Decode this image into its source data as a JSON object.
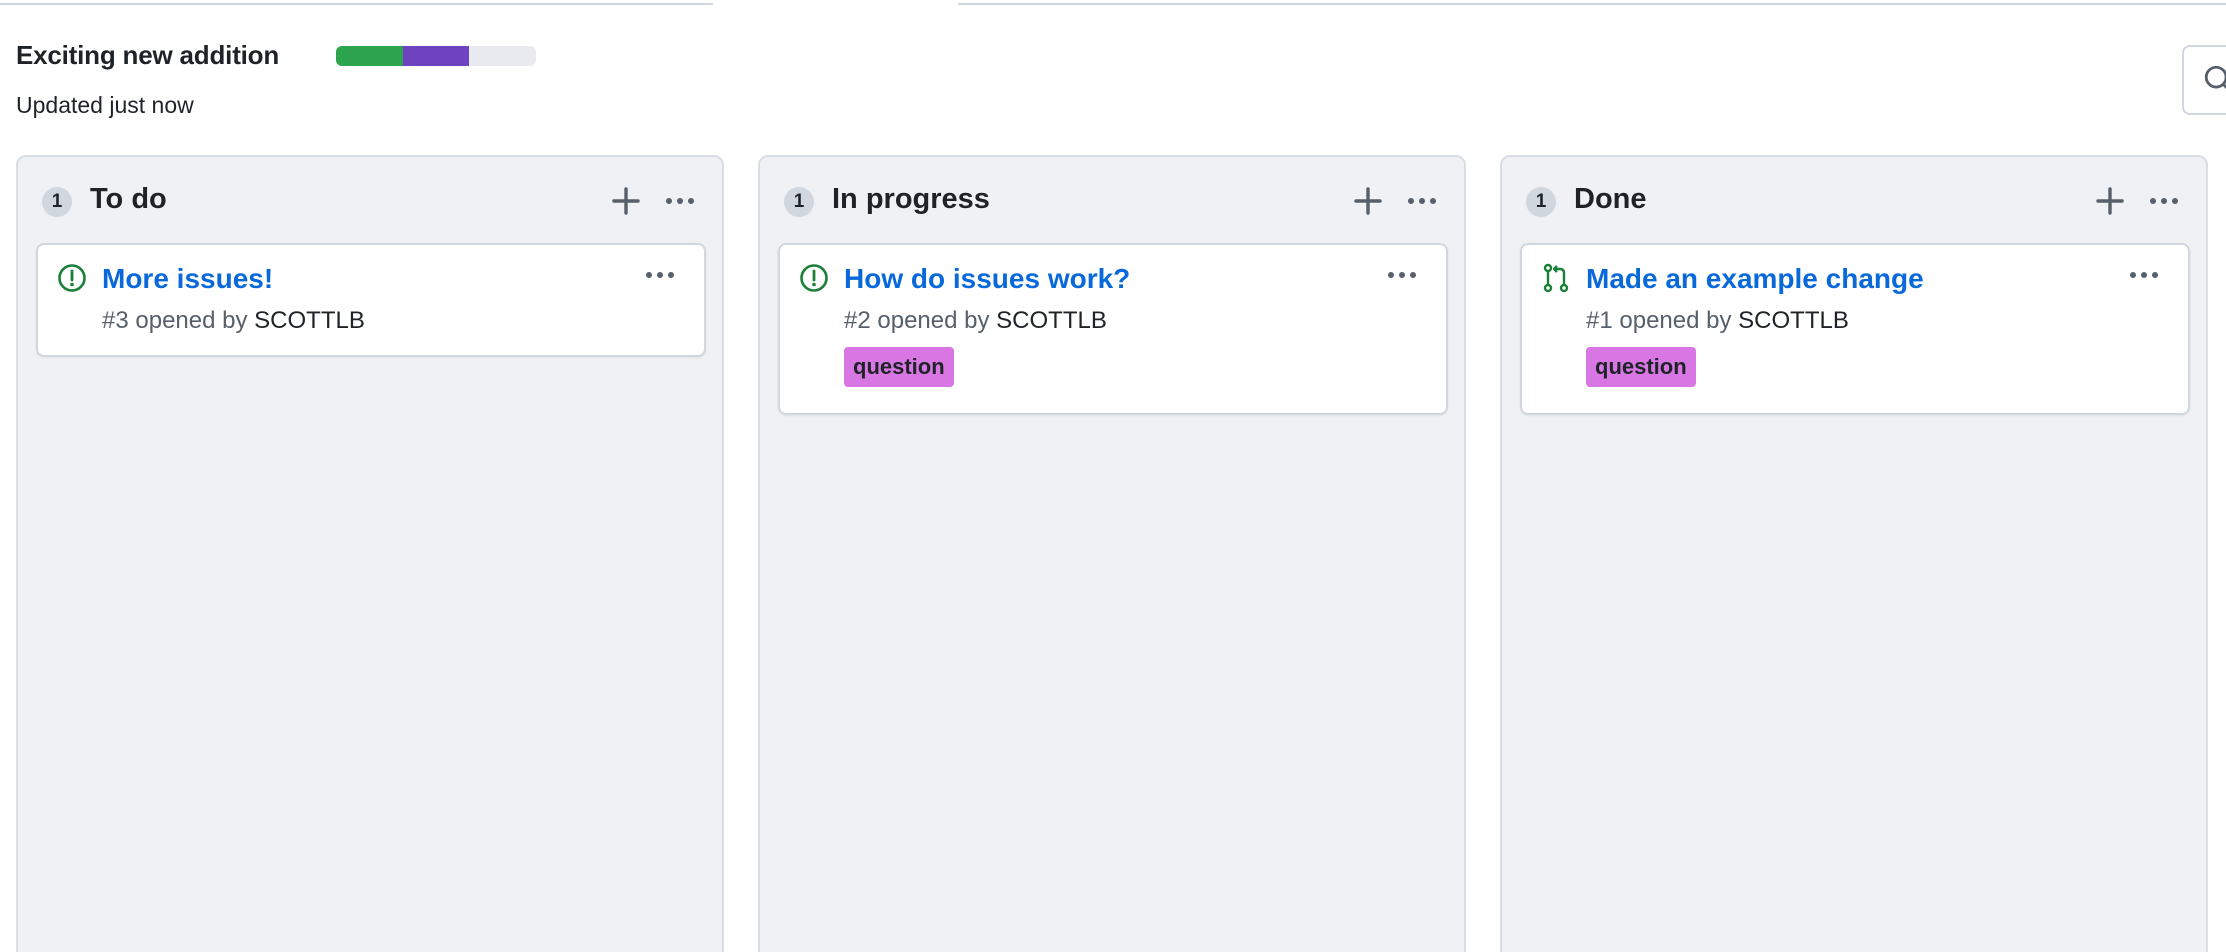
{
  "project": {
    "title": "Exciting new addition",
    "updated": "Updated just now",
    "progress": {
      "done_percent": 33.3,
      "in_progress_percent": 33.3
    },
    "colors": {
      "done": "#2da44e",
      "in_progress": "#6f42c1",
      "track": "#e8eaef"
    }
  },
  "search": {
    "icon": "search-icon"
  },
  "columns": [
    {
      "count": "1",
      "name": "To do",
      "cards": [
        {
          "icon": "issue-opened-icon",
          "title": "More issues!",
          "number": "#3",
          "opened_by": "opened by",
          "author": "SCOTTLB",
          "label": ""
        }
      ]
    },
    {
      "count": "1",
      "name": "In progress",
      "cards": [
        {
          "icon": "issue-opened-icon",
          "title": "How do issues work?",
          "number": "#2",
          "opened_by": "opened by",
          "author": "SCOTTLB",
          "label": "question"
        }
      ]
    },
    {
      "count": "1",
      "name": "Done",
      "cards": [
        {
          "icon": "pull-request-icon",
          "title": "Made an example change",
          "number": "#1",
          "opened_by": "opened by",
          "author": "SCOTTLB",
          "label": "question"
        }
      ]
    }
  ],
  "label_color": "#d876e3"
}
